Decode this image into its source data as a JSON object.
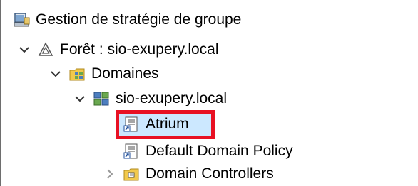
{
  "tree": {
    "root": {
      "label": "Gestion de stratégie de groupe",
      "icon": "gpmc-icon"
    },
    "forest": {
      "label": "Forêt : sio-exupery.local",
      "icon": "forest-icon",
      "expanded": true
    },
    "domains": {
      "label": "Domaines",
      "icon": "domains-folder-icon",
      "expanded": true
    },
    "domain": {
      "label": "sio-exupery.local",
      "icon": "domain-icon",
      "expanded": true
    },
    "items": [
      {
        "label": "Atrium",
        "icon": "gpo-link-icon",
        "selected": true
      },
      {
        "label": "Default Domain Policy",
        "icon": "gpo-link-icon",
        "selected": false
      },
      {
        "label": "Domain Controllers",
        "icon": "ou-folder-icon",
        "selected": false,
        "expanded": false
      }
    ]
  },
  "colors": {
    "highlight_border": "#e81123",
    "selection_background": "#cce8ff"
  }
}
